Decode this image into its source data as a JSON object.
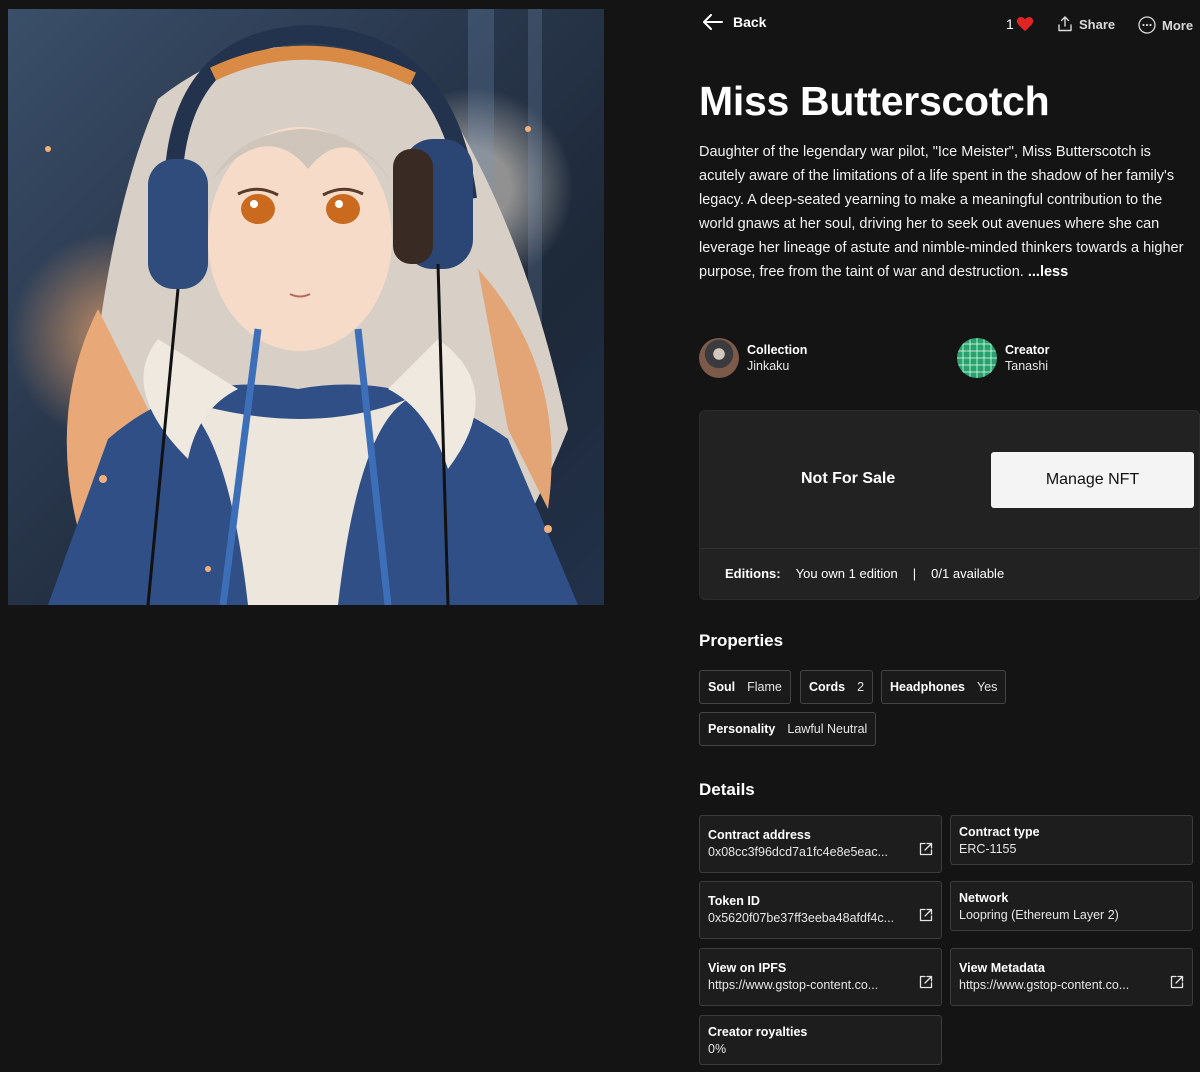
{
  "topbar": {
    "back_label": "Back",
    "likes_count": "1",
    "share_label": "Share",
    "more_label": "More"
  },
  "nft": {
    "title": "Miss Butterscotch",
    "description": "Daughter of the legendary war pilot, \"Ice Meister\", Miss Butterscotch is acutely aware of the limitations of a life spent in the shadow of her family's legacy. A deep-seated yearning to make a meaningful contribution to the world gnaws at her soul, driving her to seek out avenues where she can leverage her lineage of astute and nimble-minded thinkers towards a higher purpose, free from the taint of war and destruction.",
    "less_label": "...less"
  },
  "collection": {
    "label": "Collection",
    "value": "Jinkaku"
  },
  "creator": {
    "label": "Creator",
    "value": "Tanashi"
  },
  "sale": {
    "status": "Not For Sale",
    "manage_label": "Manage NFT",
    "editions_label": "Editions:",
    "owned": "You own 1 edition",
    "separator": "|",
    "available": "0/1 available"
  },
  "properties": {
    "heading": "Properties",
    "items": [
      {
        "key": "Soul",
        "value": "Flame"
      },
      {
        "key": "Cords",
        "value": "2"
      },
      {
        "key": "Headphones",
        "value": "Yes"
      },
      {
        "key": "Personality",
        "value": "Lawful Neutral"
      }
    ]
  },
  "details": {
    "heading": "Details",
    "contract_address": {
      "label": "Contract address",
      "value": "0x08cc3f96dcd7a1fc4e8e5eac..."
    },
    "contract_type": {
      "label": "Contract type",
      "value": "ERC-1155"
    },
    "token_id": {
      "label": "Token ID",
      "value": "0x5620f07be37ff3eeba48afdf4c..."
    },
    "network": {
      "label": "Network",
      "value": "Loopring (Ethereum Layer 2)"
    },
    "ipfs": {
      "label": "View on IPFS",
      "value": "https://www.gstop-content.co..."
    },
    "metadata": {
      "label": "View Metadata",
      "value": "https://www.gstop-content.co..."
    },
    "royalties": {
      "label": "Creator royalties",
      "value": "0%"
    }
  },
  "colors": {
    "background": "#141414",
    "heart": "#e02424",
    "card": "#222222"
  }
}
